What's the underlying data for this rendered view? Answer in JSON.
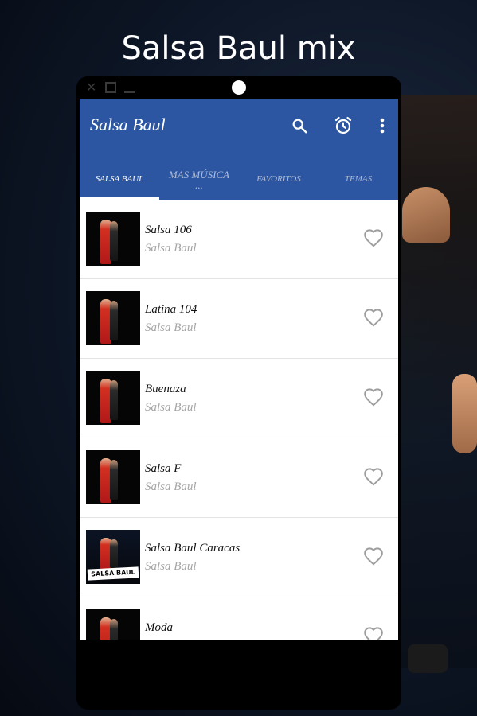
{
  "promo": {
    "title": "Salsa Baul mix"
  },
  "device": {
    "window_controls": {
      "close": "✕"
    }
  },
  "appbar": {
    "title": "Salsa Baul",
    "actions": [
      "search-icon",
      "alarm-clock-icon",
      "more-vert-icon"
    ]
  },
  "tabs": [
    {
      "label": "SALSA BAUL",
      "active": true
    },
    {
      "label": "MAS MÚSICA ...",
      "active": false
    },
    {
      "label": "FAVORITOS",
      "active": false
    },
    {
      "label": "TEMAS",
      "active": false
    }
  ],
  "stations": [
    {
      "title": "Salsa 106",
      "subtitle": "Salsa Baul"
    },
    {
      "title": "Latina 104",
      "subtitle": "Salsa Baul"
    },
    {
      "title": "Buenaza",
      "subtitle": "Salsa Baul"
    },
    {
      "title": "Salsa F",
      "subtitle": "Salsa Baul"
    },
    {
      "title": "Salsa Baul Caracas",
      "subtitle": "Salsa Baul",
      "thumb_banner": "SALSA BAUL"
    },
    {
      "title": "Moda",
      "subtitle": ""
    }
  ],
  "colors": {
    "appbar": "#2c56a1",
    "tab_active": "#ffffff",
    "tab_inactive": "#aebbd6",
    "subtitle": "#a5a5a5",
    "heart": "#9e9e9e"
  }
}
